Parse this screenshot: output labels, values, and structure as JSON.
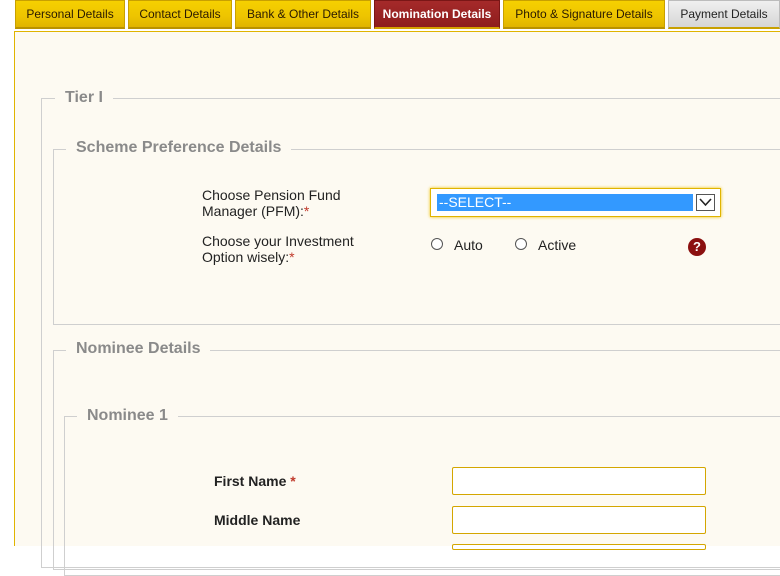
{
  "tabs": [
    {
      "label": "Personal Details"
    },
    {
      "label": "Contact Details"
    },
    {
      "label": "Bank & Other Details"
    },
    {
      "label": "Nomination Details"
    },
    {
      "label": "Photo & Signature Details"
    },
    {
      "label": "Payment Details"
    }
  ],
  "active_tab": "Nomination Details",
  "tier": {
    "legend": "Tier I"
  },
  "scheme": {
    "legend": "Scheme Preference Details",
    "pfm_label_line1": "Choose Pension Fund",
    "pfm_label_line2": "Manager (PFM):",
    "pfm_selected": "--SELECT--",
    "investment_label_line1": "Choose your Investment",
    "investment_label_line2": "Option wisely:",
    "required_mark": "*",
    "options": [
      "Auto",
      "Active"
    ],
    "help_icon": "?"
  },
  "nominee_details": {
    "legend": "Nominee Details"
  },
  "nominee1": {
    "legend": "Nominee 1",
    "first_name_label": "First Name",
    "middle_name_label": "Middle Name",
    "required_mark": "*",
    "first_name_value": "",
    "middle_name_value": ""
  },
  "colors": {
    "tab_gold": "#edc400",
    "tab_active": "#8e1d1d",
    "select_highlight": "#3399ff",
    "help_icon_bg": "#8b1010"
  }
}
